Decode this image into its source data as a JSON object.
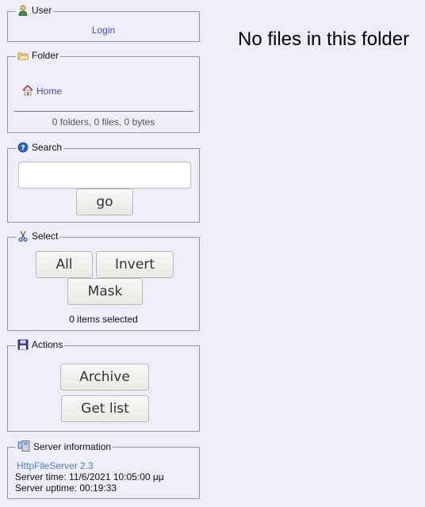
{
  "user": {
    "title": "User",
    "login": "Login"
  },
  "folder": {
    "title": "Folder",
    "home": "Home",
    "summary": "0 folders, 0 files, 0 bytes"
  },
  "search": {
    "title": "Search",
    "value": "",
    "go": "go"
  },
  "select": {
    "title": "Select",
    "all": "All",
    "invert": "Invert",
    "mask": "Mask",
    "status": "0 items selected"
  },
  "actions": {
    "title": "Actions",
    "archive": "Archive",
    "getlist": "Get list"
  },
  "server": {
    "title": "Server information",
    "app": "HttpFileServer 2.3",
    "time": "Server time: 11/6/2021 10:05:00 μμ",
    "uptime": "Server uptime: 00:19:33"
  },
  "main": {
    "empty": "No files in this folder"
  }
}
